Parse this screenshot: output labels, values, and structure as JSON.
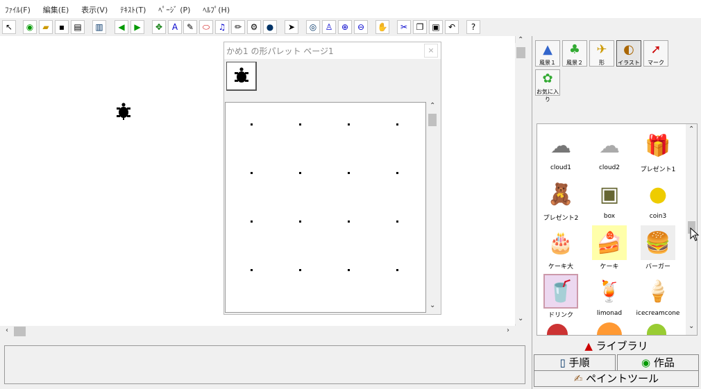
{
  "menu": [
    "ﾌｧｲﾙ(F)",
    "編集(E)",
    "表示(V)",
    "ﾃｷｽﾄ(T)",
    "ﾍﾟｰｼﾞ (P)",
    "ﾍﾙﾌﾟ(H)"
  ],
  "toolbar_icons": [
    "cursor",
    "globe",
    "open",
    "save",
    "print",
    "layout",
    "back",
    "forward",
    "turtle",
    "text-box",
    "draw",
    "eraser",
    "music",
    "pencil",
    "film",
    "record",
    "pointer",
    "eye",
    "stamp",
    "zoom-in",
    "zoom-out",
    "stop",
    "cut",
    "copy",
    "paste",
    "undo",
    "help"
  ],
  "palette": {
    "title": "かめ1 の形パレット ページ1",
    "close": "×"
  },
  "categories": [
    "風景１",
    "風景２",
    "形",
    "イラスト",
    "マーク"
  ],
  "favorites": "お気に入り",
  "library_items": [
    {
      "label": "cloud1",
      "icon": "☁"
    },
    {
      "label": "cloud2",
      "icon": "☁"
    },
    {
      "label": "プレゼント1",
      "icon": "🎁"
    },
    {
      "label": "プレゼント2",
      "icon": "🧸"
    },
    {
      "label": "box",
      "icon": "▣"
    },
    {
      "label": "coin3",
      "icon": "●"
    },
    {
      "label": "ケーキ大",
      "icon": "🎂"
    },
    {
      "label": "ケーキ",
      "icon": "🍰"
    },
    {
      "label": "バーガー",
      "icon": "🍔"
    },
    {
      "label": "ドリンク",
      "icon": "🥤"
    },
    {
      "label": "limonad",
      "icon": "🍹"
    },
    {
      "label": "icecreamcone",
      "icon": "🍦"
    }
  ],
  "buttons": {
    "library": "ライブラリ",
    "procedure": "手順",
    "works": "作品",
    "paint": "ペイントツール"
  }
}
